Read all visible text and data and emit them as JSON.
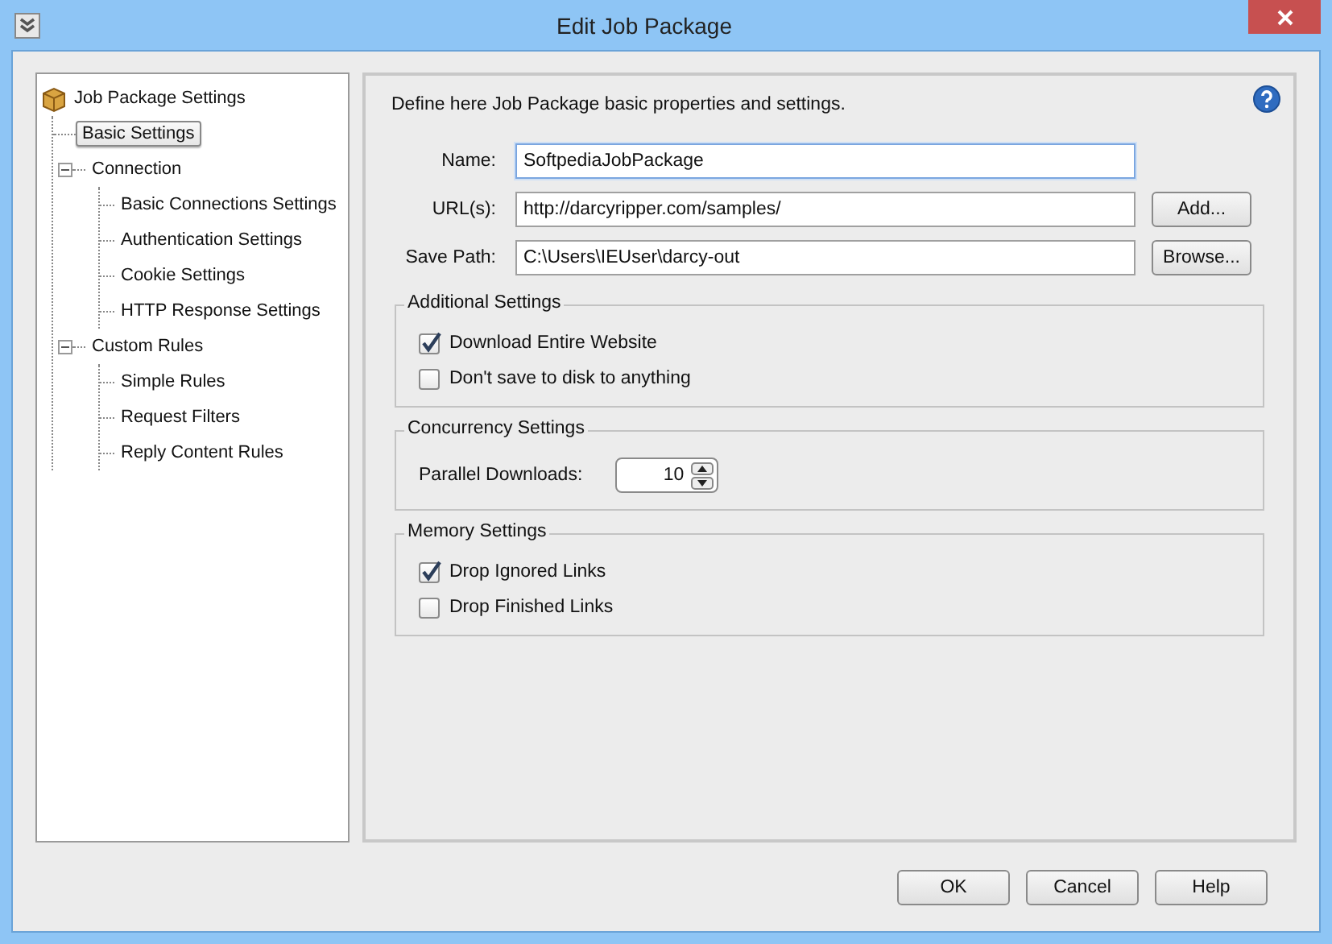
{
  "window": {
    "title": "Edit Job Package"
  },
  "tree": {
    "label": "Job Package Settings",
    "selected": false,
    "children": [
      {
        "label": "Basic Settings",
        "selected": true
      },
      {
        "label": "Connection",
        "selected": false,
        "expanded": true,
        "children": [
          {
            "label": "Basic Connections Settings",
            "selected": false
          },
          {
            "label": "Authentication Settings",
            "selected": false
          },
          {
            "label": "Cookie Settings",
            "selected": false
          },
          {
            "label": "HTTP Response Settings",
            "selected": false
          }
        ]
      },
      {
        "label": "Custom Rules",
        "selected": false,
        "expanded": true,
        "children": [
          {
            "label": "Simple Rules",
            "selected": false
          },
          {
            "label": "Request Filters",
            "selected": false
          },
          {
            "label": "Reply Content Rules",
            "selected": false
          }
        ]
      }
    ]
  },
  "form": {
    "description": "Define here Job Package basic properties and settings.",
    "fields": [
      {
        "label": "Name:",
        "value": "SoftpediaJobPackage",
        "focused": true
      },
      {
        "label": "URL(s):",
        "value": "http://darcyripper.com/samples/",
        "focused": false,
        "button": "Add..."
      },
      {
        "label": "Save Path:",
        "value": "C:\\Users\\IEUser\\darcy-out",
        "focused": false,
        "button": "Browse..."
      }
    ],
    "groups": [
      {
        "title": "Additional Settings",
        "items": [
          {
            "kind": "checkbox",
            "label": "Download Entire Website",
            "checked": true
          },
          {
            "kind": "checkbox",
            "label": "Don't save to disk to anything",
            "checked": false
          }
        ]
      },
      {
        "title": "Concurrency Settings",
        "items": [
          {
            "kind": "spinner",
            "label": "Parallel Downloads:",
            "value": "10"
          }
        ]
      },
      {
        "title": "Memory Settings",
        "items": [
          {
            "kind": "checkbox",
            "label": "Drop Ignored Links",
            "checked": true
          },
          {
            "kind": "checkbox",
            "label": "Drop Finished Links",
            "checked": false
          }
        ]
      }
    ]
  },
  "buttons": [
    "OK",
    "Cancel",
    "Help"
  ]
}
